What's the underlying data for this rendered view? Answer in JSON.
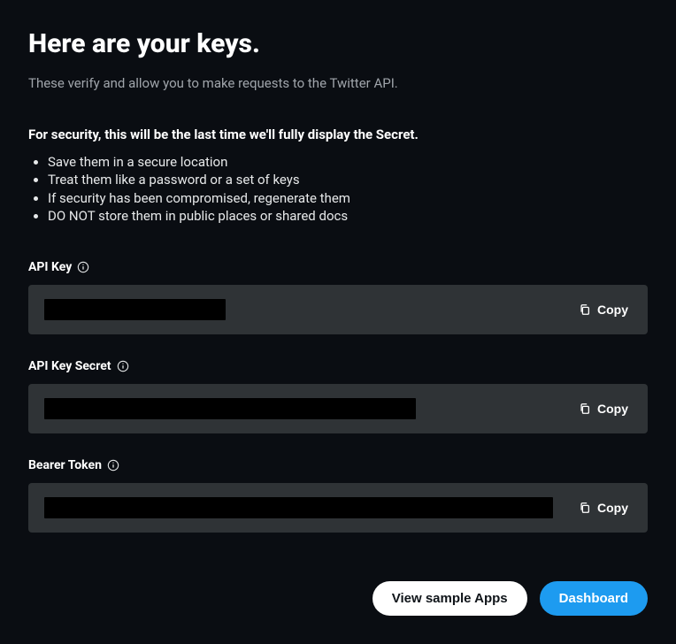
{
  "header": {
    "title": "Here are your keys.",
    "subtitle": "These verify and allow you to make requests to the Twitter API."
  },
  "security": {
    "warning": "For security, this will be the last time we'll fully display the Secret.",
    "rules": [
      "Save them in a secure location",
      "Treat them like a password or a set of keys",
      "If security has been compromised, regenerate them",
      "DO NOT store them in public places or shared docs"
    ]
  },
  "keys": {
    "api_key": {
      "label": "API Key",
      "copy_label": "Copy"
    },
    "api_key_secret": {
      "label": "API Key Secret",
      "copy_label": "Copy"
    },
    "bearer_token": {
      "label": "Bearer Token",
      "copy_label": "Copy"
    }
  },
  "buttons": {
    "view_sample": "View sample Apps",
    "dashboard": "Dashboard"
  }
}
